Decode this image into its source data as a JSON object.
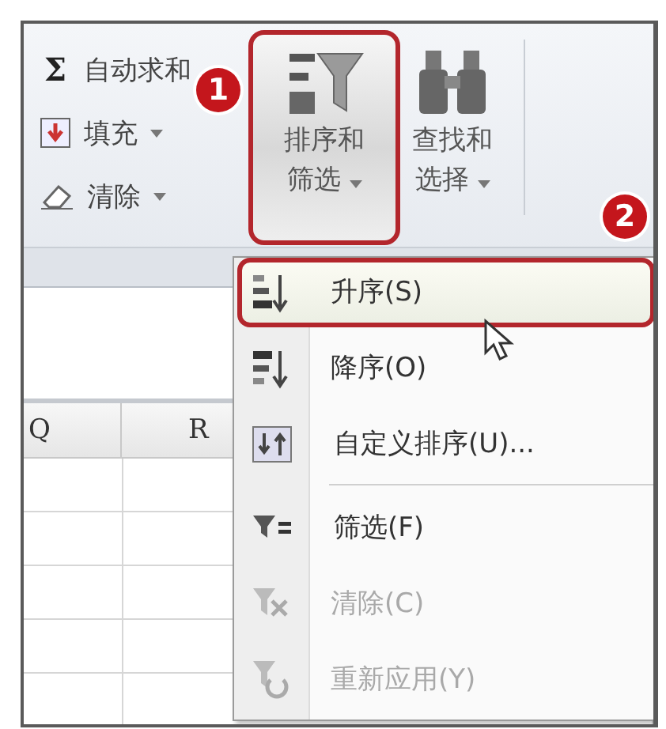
{
  "ribbon": {
    "small_commands": [
      {
        "kind": "sum",
        "symbol": "Σ",
        "label": "自动求和",
        "dropdown": false
      },
      {
        "kind": "fill",
        "label": "填充",
        "dropdown": true
      },
      {
        "kind": "clear",
        "label": "清除",
        "dropdown": true
      }
    ],
    "big_buttons": [
      {
        "kind": "sort",
        "lines": [
          "排序和",
          "筛选"
        ],
        "selected": true
      },
      {
        "kind": "find",
        "lines": [
          "查找和",
          "选择"
        ],
        "selected": false
      }
    ]
  },
  "grid": {
    "columns": [
      "Q",
      "R"
    ]
  },
  "menu": {
    "items": [
      {
        "kind": "asc",
        "label": "升序(S)",
        "highlighted": true,
        "disabled": false,
        "separator_before": false
      },
      {
        "kind": "desc",
        "label": "降序(O)",
        "highlighted": false,
        "disabled": false,
        "separator_before": false
      },
      {
        "kind": "custom",
        "label": "自定义排序(U)...",
        "highlighted": false,
        "disabled": false,
        "separator_before": false
      },
      {
        "kind": "filter",
        "label": "筛选(F)",
        "highlighted": false,
        "disabled": false,
        "separator_before": true
      },
      {
        "kind": "clear",
        "label": "清除(C)",
        "highlighted": false,
        "disabled": true,
        "separator_before": false
      },
      {
        "kind": "reapply",
        "label": "重新应用(Y)",
        "highlighted": false,
        "disabled": true,
        "separator_before": false
      }
    ]
  },
  "callouts": [
    {
      "label": "1"
    },
    {
      "label": "2"
    }
  ]
}
